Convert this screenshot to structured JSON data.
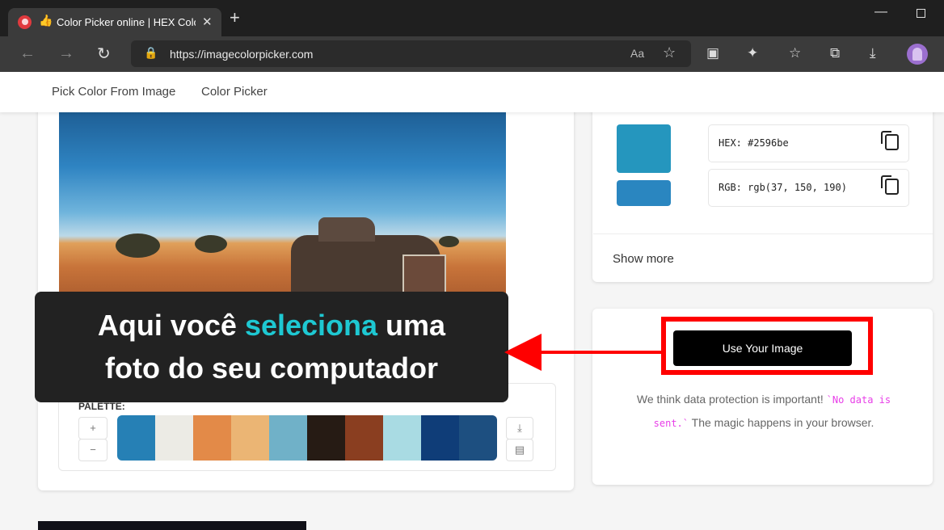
{
  "browser": {
    "tab_title": "Color Picker online | HEX Color Picker",
    "tab_close": "✕",
    "new_tab": "+",
    "url": "https://imagecolorpicker.com"
  },
  "nav": {
    "pick_from_image": "Pick Color From Image",
    "color_picker": "Color Picker"
  },
  "palette": {
    "label": "PALETTE:",
    "add": "+",
    "remove": "−",
    "colors": [
      "#2680b5",
      "#ecebe5",
      "#e38a48",
      "#ebb574",
      "#70b1c8",
      "#261b14",
      "#8a3e20",
      "#a9dbe3",
      "#0f3d78",
      "#1d4f80"
    ]
  },
  "selected": {
    "hex_text": "HEX: #2596be",
    "rgb_text": "RGB: rgb(37, 150, 190)",
    "color_primary": "#2596be",
    "color_secondary": "#2a86c0",
    "show_more": "Show more"
  },
  "upload": {
    "button": "Use Your Image",
    "privacy_before": "We think data protection is important! ",
    "privacy_code": "`No data is sent.`",
    "privacy_after": " The magic happens in your browser."
  },
  "annotation": {
    "line1_a": "Aqui você ",
    "line1_highlight": "seleciona",
    "line1_b": " uma",
    "line2": "foto do seu computador"
  }
}
